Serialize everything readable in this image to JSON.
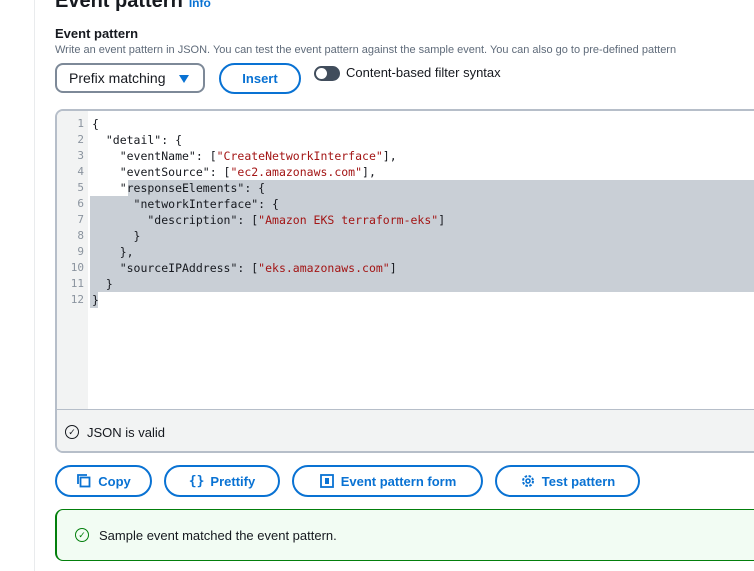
{
  "section": {
    "title": "Event pattern",
    "info": "Info"
  },
  "field": {
    "label": "Event pattern",
    "description": "Write an event pattern in JSON. You can test the event pattern against the sample event. You can also go to pre-defined pattern"
  },
  "controls": {
    "select_value": "Prefix matching",
    "insert_label": "Insert",
    "toggle_label": "Content-based filter syntax"
  },
  "editor": {
    "lines": [
      {
        "n": "1",
        "segs": [
          {
            "t": "{",
            "c": "k"
          }
        ]
      },
      {
        "n": "2",
        "segs": [
          {
            "t": "  \"detail\": {",
            "c": "k"
          }
        ]
      },
      {
        "n": "3",
        "segs": [
          {
            "t": "    \"eventName\": [",
            "c": "k"
          },
          {
            "t": "\"CreateNetworkInterface\"",
            "c": "s"
          },
          {
            "t": "],",
            "c": "k"
          }
        ]
      },
      {
        "n": "4",
        "segs": [
          {
            "t": "    \"eventSource\": [",
            "c": "k"
          },
          {
            "t": "\"ec2.amazonaws.com\"",
            "c": "s"
          },
          {
            "t": "],",
            "c": "k"
          }
        ]
      },
      {
        "n": "5",
        "segs": [
          {
            "t": "    \"responseElements\": {",
            "c": "k"
          }
        ]
      },
      {
        "n": "6",
        "segs": [
          {
            "t": "      \"networkInterface\": {",
            "c": "k"
          }
        ]
      },
      {
        "n": "7",
        "segs": [
          {
            "t": "        \"description\": [",
            "c": "k"
          },
          {
            "t": "\"Amazon EKS terraform-eks\"",
            "c": "s"
          },
          {
            "t": "]",
            "c": "k"
          }
        ]
      },
      {
        "n": "8",
        "segs": [
          {
            "t": "      }",
            "c": "k"
          }
        ]
      },
      {
        "n": "9",
        "segs": [
          {
            "t": "    },",
            "c": "k"
          }
        ]
      },
      {
        "n": "10",
        "segs": [
          {
            "t": "    \"sourceIPAddress\": [",
            "c": "k"
          },
          {
            "t": "\"eks.amazonaws.com\"",
            "c": "s"
          },
          {
            "t": "]",
            "c": "k"
          }
        ]
      },
      {
        "n": "11",
        "segs": [
          {
            "t": "  }",
            "c": "k"
          }
        ]
      },
      {
        "n": "12",
        "segs": [
          {
            "t": "}",
            "c": "k"
          }
        ]
      }
    ],
    "status": "JSON is valid"
  },
  "actions": {
    "copy": "Copy",
    "prettify": "Prettify",
    "form": "Event pattern form",
    "test": "Test pattern"
  },
  "alert": {
    "text": "Sample event matched the event pattern."
  }
}
